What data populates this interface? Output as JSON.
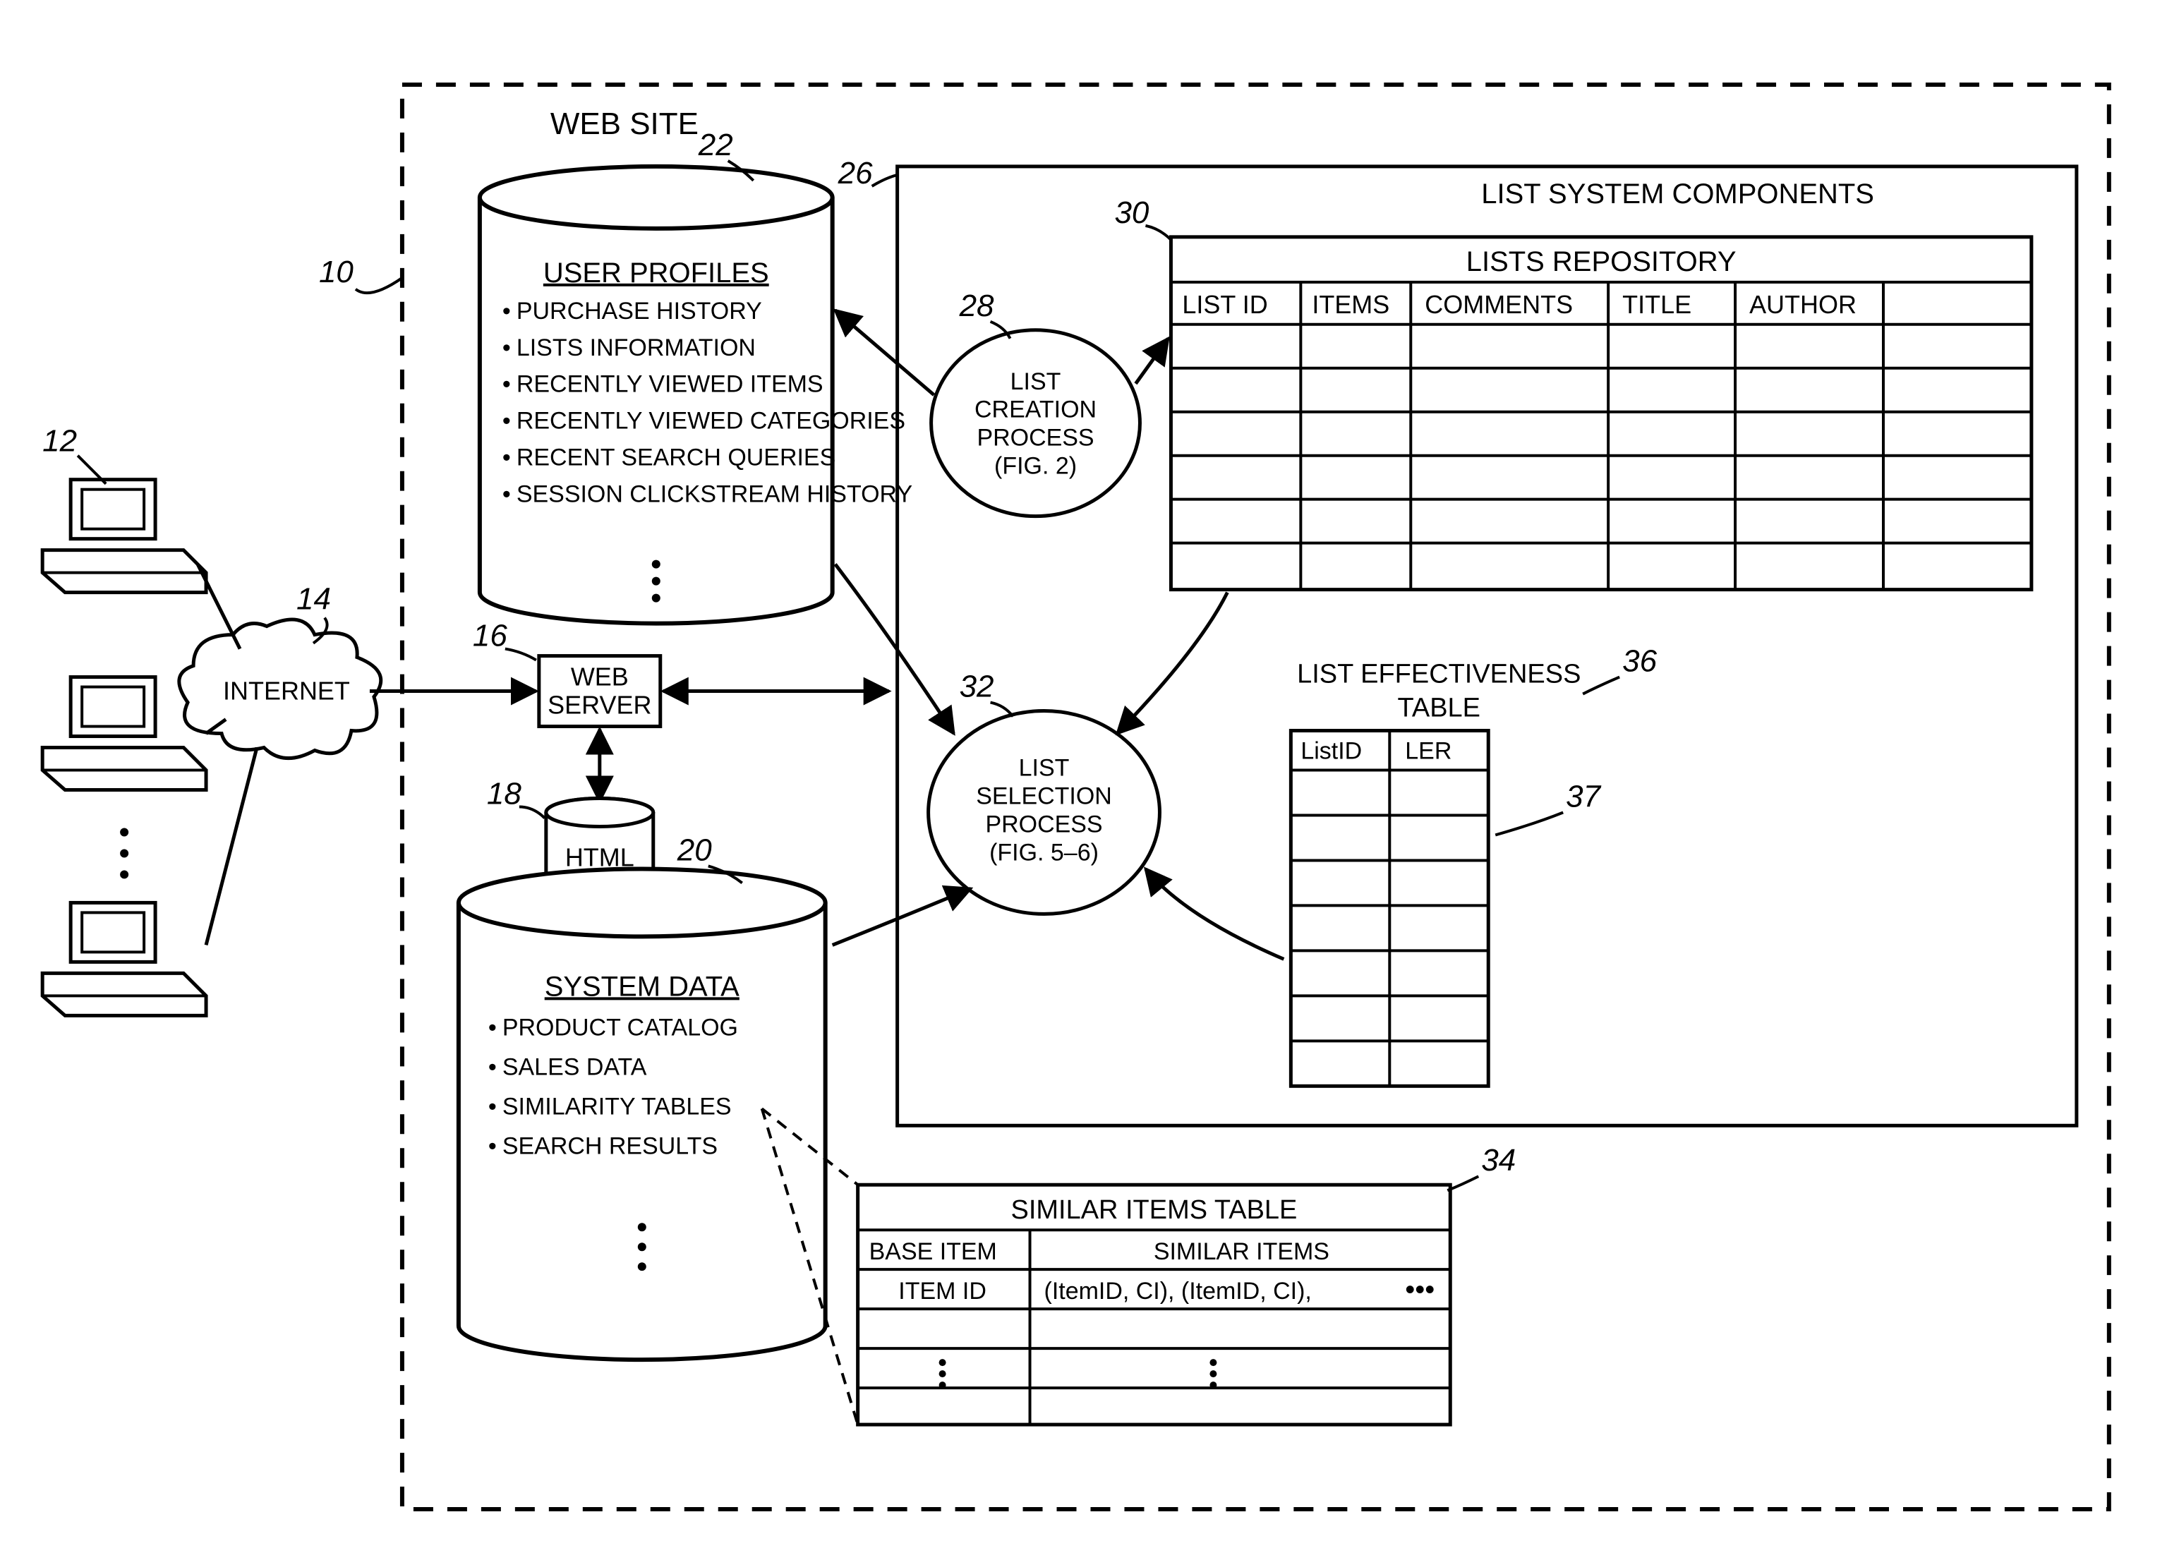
{
  "refs": {
    "r10": "10",
    "r12": "12",
    "r14": "14",
    "r16": "16",
    "r18": "18",
    "r20": "20",
    "r22": "22",
    "r26": "26",
    "r28": "28",
    "r30": "30",
    "r32": "32",
    "r34": "34",
    "r36": "36",
    "r37": "37"
  },
  "labels": {
    "website": "WEB SITE",
    "internet": "INTERNET",
    "webserver_l1": "WEB",
    "webserver_l2": "SERVER",
    "html": "HTML",
    "userprofiles_title": "USER PROFILES",
    "up1": "PURCHASE HISTORY",
    "up2": "LISTS INFORMATION",
    "up3": "RECENTLY VIEWED ITEMS",
    "up4": "RECENTLY VIEWED CATEGORIES",
    "up5": "RECENT SEARCH QUERIES",
    "up6": "SESSION CLICKSTREAM HISTORY",
    "systemdata_title": "SYSTEM DATA",
    "sd1": "PRODUCT CATALOG",
    "sd2": "SALES DATA",
    "sd3": "SIMILARITY TABLES",
    "sd4": "SEARCH RESULTS",
    "list_comp": "LIST SYSTEM COMPONENTS",
    "lists_repo": "LISTS REPOSITORY",
    "lr_c1": "LIST ID",
    "lr_c2": "ITEMS",
    "lr_c3": "COMMENTS",
    "lr_c4": "TITLE",
    "lr_c5": "AUTHOR",
    "lcp_l1": "LIST",
    "lcp_l2": "CREATION",
    "lcp_l3": "PROCESS",
    "lcp_l4": "(FIG. 2)",
    "lsp_l1": "LIST",
    "lsp_l2": "SELECTION",
    "lsp_l3": "PROCESS",
    "lsp_l4": "(FIG. 5–6)",
    "let_l1": "LIST EFFECTIVENESS",
    "let_l2": "TABLE",
    "let_c1": "ListID",
    "let_c2": "LER",
    "sit_title": "SIMILAR ITEMS TABLE",
    "sit_h1": "BASE ITEM",
    "sit_h2": "SIMILAR ITEMS",
    "sit_r1a": "ITEM ID",
    "sit_r1b": "(ItemID, CI), (ItemID, CI),",
    "dots": "•••"
  }
}
